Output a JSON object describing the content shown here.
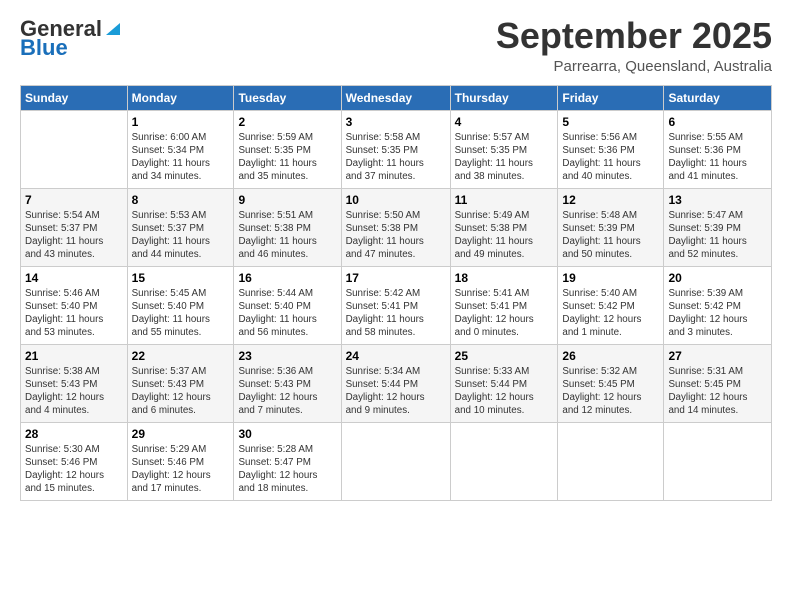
{
  "header": {
    "logo_general": "General",
    "logo_blue": "Blue",
    "month": "September 2025",
    "location": "Parrearra, Queensland, Australia"
  },
  "weekdays": [
    "Sunday",
    "Monday",
    "Tuesday",
    "Wednesday",
    "Thursday",
    "Friday",
    "Saturday"
  ],
  "weeks": [
    [
      {
        "day": "",
        "info": ""
      },
      {
        "day": "1",
        "info": "Sunrise: 6:00 AM\nSunset: 5:34 PM\nDaylight: 11 hours\nand 34 minutes."
      },
      {
        "day": "2",
        "info": "Sunrise: 5:59 AM\nSunset: 5:35 PM\nDaylight: 11 hours\nand 35 minutes."
      },
      {
        "day": "3",
        "info": "Sunrise: 5:58 AM\nSunset: 5:35 PM\nDaylight: 11 hours\nand 37 minutes."
      },
      {
        "day": "4",
        "info": "Sunrise: 5:57 AM\nSunset: 5:35 PM\nDaylight: 11 hours\nand 38 minutes."
      },
      {
        "day": "5",
        "info": "Sunrise: 5:56 AM\nSunset: 5:36 PM\nDaylight: 11 hours\nand 40 minutes."
      },
      {
        "day": "6",
        "info": "Sunrise: 5:55 AM\nSunset: 5:36 PM\nDaylight: 11 hours\nand 41 minutes."
      }
    ],
    [
      {
        "day": "7",
        "info": "Sunrise: 5:54 AM\nSunset: 5:37 PM\nDaylight: 11 hours\nand 43 minutes."
      },
      {
        "day": "8",
        "info": "Sunrise: 5:53 AM\nSunset: 5:37 PM\nDaylight: 11 hours\nand 44 minutes."
      },
      {
        "day": "9",
        "info": "Sunrise: 5:51 AM\nSunset: 5:38 PM\nDaylight: 11 hours\nand 46 minutes."
      },
      {
        "day": "10",
        "info": "Sunrise: 5:50 AM\nSunset: 5:38 PM\nDaylight: 11 hours\nand 47 minutes."
      },
      {
        "day": "11",
        "info": "Sunrise: 5:49 AM\nSunset: 5:38 PM\nDaylight: 11 hours\nand 49 minutes."
      },
      {
        "day": "12",
        "info": "Sunrise: 5:48 AM\nSunset: 5:39 PM\nDaylight: 11 hours\nand 50 minutes."
      },
      {
        "day": "13",
        "info": "Sunrise: 5:47 AM\nSunset: 5:39 PM\nDaylight: 11 hours\nand 52 minutes."
      }
    ],
    [
      {
        "day": "14",
        "info": "Sunrise: 5:46 AM\nSunset: 5:40 PM\nDaylight: 11 hours\nand 53 minutes."
      },
      {
        "day": "15",
        "info": "Sunrise: 5:45 AM\nSunset: 5:40 PM\nDaylight: 11 hours\nand 55 minutes."
      },
      {
        "day": "16",
        "info": "Sunrise: 5:44 AM\nSunset: 5:40 PM\nDaylight: 11 hours\nand 56 minutes."
      },
      {
        "day": "17",
        "info": "Sunrise: 5:42 AM\nSunset: 5:41 PM\nDaylight: 11 hours\nand 58 minutes."
      },
      {
        "day": "18",
        "info": "Sunrise: 5:41 AM\nSunset: 5:41 PM\nDaylight: 12 hours\nand 0 minutes."
      },
      {
        "day": "19",
        "info": "Sunrise: 5:40 AM\nSunset: 5:42 PM\nDaylight: 12 hours\nand 1 minute."
      },
      {
        "day": "20",
        "info": "Sunrise: 5:39 AM\nSunset: 5:42 PM\nDaylight: 12 hours\nand 3 minutes."
      }
    ],
    [
      {
        "day": "21",
        "info": "Sunrise: 5:38 AM\nSunset: 5:43 PM\nDaylight: 12 hours\nand 4 minutes."
      },
      {
        "day": "22",
        "info": "Sunrise: 5:37 AM\nSunset: 5:43 PM\nDaylight: 12 hours\nand 6 minutes."
      },
      {
        "day": "23",
        "info": "Sunrise: 5:36 AM\nSunset: 5:43 PM\nDaylight: 12 hours\nand 7 minutes."
      },
      {
        "day": "24",
        "info": "Sunrise: 5:34 AM\nSunset: 5:44 PM\nDaylight: 12 hours\nand 9 minutes."
      },
      {
        "day": "25",
        "info": "Sunrise: 5:33 AM\nSunset: 5:44 PM\nDaylight: 12 hours\nand 10 minutes."
      },
      {
        "day": "26",
        "info": "Sunrise: 5:32 AM\nSunset: 5:45 PM\nDaylight: 12 hours\nand 12 minutes."
      },
      {
        "day": "27",
        "info": "Sunrise: 5:31 AM\nSunset: 5:45 PM\nDaylight: 12 hours\nand 14 minutes."
      }
    ],
    [
      {
        "day": "28",
        "info": "Sunrise: 5:30 AM\nSunset: 5:46 PM\nDaylight: 12 hours\nand 15 minutes."
      },
      {
        "day": "29",
        "info": "Sunrise: 5:29 AM\nSunset: 5:46 PM\nDaylight: 12 hours\nand 17 minutes."
      },
      {
        "day": "30",
        "info": "Sunrise: 5:28 AM\nSunset: 5:47 PM\nDaylight: 12 hours\nand 18 minutes."
      },
      {
        "day": "",
        "info": ""
      },
      {
        "day": "",
        "info": ""
      },
      {
        "day": "",
        "info": ""
      },
      {
        "day": "",
        "info": ""
      }
    ]
  ]
}
